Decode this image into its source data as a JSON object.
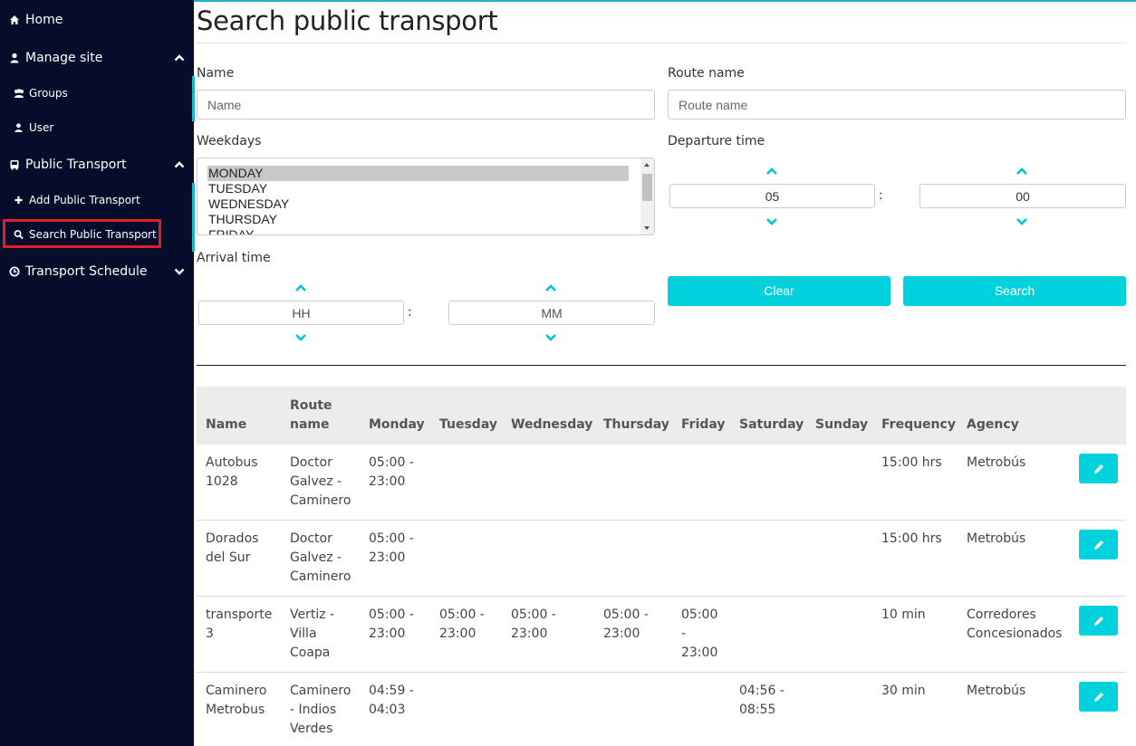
{
  "sidebar": {
    "home": "Home",
    "manage_site": "Manage site",
    "groups": "Groups",
    "user": "User",
    "public_transport": "Public Transport",
    "add_public_transport": "Add Public Transport",
    "search_public_transport": "Search Public Transport",
    "transport_schedule": "Transport Schedule"
  },
  "page": {
    "title": "Search public transport"
  },
  "form": {
    "name_label": "Name",
    "name_placeholder": "Name",
    "route_label": "Route name",
    "route_placeholder": "Route name",
    "weekdays_label": "Weekdays",
    "weekdays": [
      "MONDAY",
      "TUESDAY",
      "WEDNESDAY",
      "THURSDAY",
      "FRIDAY"
    ],
    "weekdays_selected": "MONDAY",
    "departure_label": "Departure time",
    "departure_hour": "05",
    "departure_minute": "00",
    "arrival_label": "Arrival time",
    "arrival_hour_placeholder": "HH",
    "arrival_minute_placeholder": "MM",
    "colon": ":",
    "clear_button": "Clear",
    "search_button": "Search"
  },
  "table": {
    "headers": [
      "Name",
      "Route name",
      "Monday",
      "Tuesday",
      "Wednesday",
      "Thursday",
      "Friday",
      "Saturday",
      "Sunday",
      "Frequency",
      "Agency"
    ],
    "rows": [
      {
        "name": "Autobus 1028",
        "route": "Doctor Galvez - Caminero",
        "monday": "05:00 - 23:00",
        "tuesday": "",
        "wednesday": "",
        "thursday": "",
        "friday": "",
        "saturday": "",
        "sunday": "",
        "frequency": "15:00 hrs",
        "agency": "Metrobús"
      },
      {
        "name": "Dorados del Sur",
        "route": "Doctor Galvez - Caminero",
        "monday": "05:00 - 23:00",
        "tuesday": "",
        "wednesday": "",
        "thursday": "",
        "friday": "",
        "saturday": "",
        "sunday": "",
        "frequency": "15:00 hrs",
        "agency": "Metrobús"
      },
      {
        "name": "transporte 3",
        "route": "Vertiz - Villa Coapa",
        "monday": "05:00 - 23:00",
        "tuesday": "05:00 - 23:00",
        "wednesday": "05:00 - 23:00",
        "thursday": "05:00 - 23:00",
        "friday": "05:00 - 23:00",
        "saturday": "",
        "sunday": "",
        "frequency": "10 min",
        "agency": "Corredores Concesionados"
      },
      {
        "name": "Caminero Metrobus",
        "route": "Caminero - Indios Verdes",
        "monday": "04:59 - 04:03",
        "tuesday": "",
        "wednesday": "",
        "thursday": "",
        "friday": "",
        "saturday": "04:56 - 08:55",
        "sunday": "",
        "frequency": "30 min",
        "agency": "Metrobús"
      }
    ]
  },
  "colors": {
    "accent": "#00d2dd",
    "sidebar_bg": "#050d2b",
    "highlight": "#e31e24"
  }
}
